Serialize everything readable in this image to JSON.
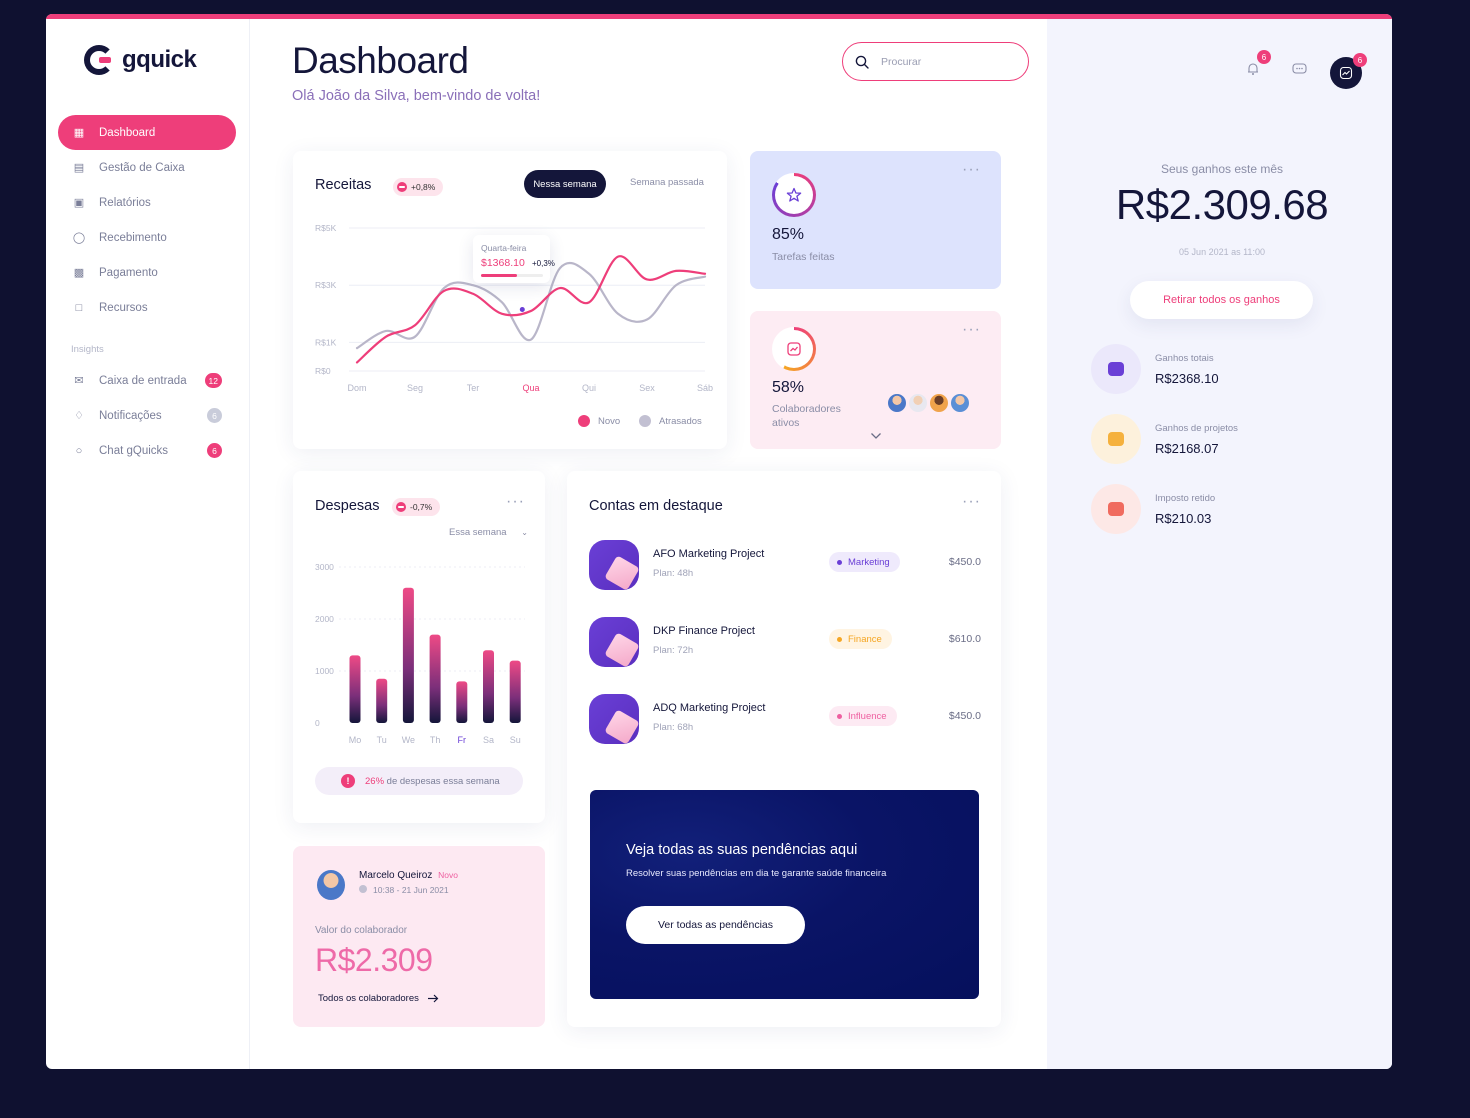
{
  "brand": {
    "name": "gquick",
    "accent": "#ee3e7a",
    "dark": "#14163a"
  },
  "sidebar": {
    "items": [
      {
        "label": "Dashboard",
        "icon": "grid-icon",
        "active": true
      },
      {
        "label": "Gestão de Caixa",
        "icon": "chart-icon"
      },
      {
        "label": "Relatórios",
        "icon": "document-icon"
      },
      {
        "label": "Recebimento",
        "icon": "receive-icon"
      },
      {
        "label": "Pagamento",
        "icon": "payment-icon"
      },
      {
        "label": "Recursos",
        "icon": "wallet-icon"
      }
    ],
    "section_label": "Insights",
    "insights": [
      {
        "label": "Caixa de entrada",
        "icon": "mail-icon",
        "badge": "12"
      },
      {
        "label": "Notificações",
        "icon": "bell-icon",
        "badge": "6"
      },
      {
        "label": "Chat gQuicks",
        "icon": "chat-icon",
        "badge": "6"
      }
    ]
  },
  "header": {
    "title": "Dashboard",
    "subtitle": "Olá João da Silva, bem-vindo de volta!",
    "search_placeholder": "Procurar"
  },
  "receitas": {
    "title": "Receitas",
    "change": "+0,8%",
    "tab_active": "Nessa semana",
    "tab_inactive": "Semana passada",
    "tooltip": {
      "day": "Quarta-feira",
      "value": "$1368.10",
      "change": "+0,3%"
    },
    "legend": [
      "Novo",
      "Atrasados"
    ]
  },
  "stats": [
    {
      "value": "85%",
      "label": "Tarefas feitas",
      "icon": "star-icon"
    },
    {
      "value": "58%",
      "label": "Colaboradores ativos",
      "icon": "trend-icon"
    }
  ],
  "despesas": {
    "title": "Despesas",
    "change": "-0,7%",
    "period": "Essa semana",
    "footer_pct": "26%",
    "footer_text": "de despesas essa semana"
  },
  "colaborador": {
    "name": "Marcelo Queiroz",
    "tag": "Novo",
    "time": "10:38 - 21 Jun 2021",
    "label": "Valor do colaborador",
    "value": "R$2.309",
    "link": "Todos os colaboradores"
  },
  "contas": {
    "title": "Contas em destaque",
    "items": [
      {
        "name": "AFO Marketing Project",
        "plan": "Plan: 48h",
        "tag": "Marketing",
        "tag_color": "#6a3fd6",
        "tag_bg": "#efeafc",
        "amount": "$450.0"
      },
      {
        "name": "DKP Finance Project",
        "plan": "Plan: 72h",
        "tag": "Finance",
        "tag_color": "#f5a623",
        "tag_bg": "#fff4e2",
        "amount": "$610.0"
      },
      {
        "name": "ADQ Marketing Project",
        "plan": "Plan: 68h",
        "tag": "Influence",
        "tag_color": "#ee5fa0",
        "tag_bg": "#fdeaf3",
        "amount": "$450.0"
      }
    ],
    "banner_title": "Veja todas as suas pendências aqui",
    "banner_text": "Resolver suas pendências em dia te garante saúde financeira",
    "banner_button": "Ver todas as pendências"
  },
  "right": {
    "notif_count": "6",
    "profile_count": "6",
    "earn_label": "Seus ganhos este mês",
    "earn_value": "R$2.309.68",
    "earn_date": "05 Jun 2021 as 11:00",
    "withdraw": "Retirar todos os ganhos",
    "ganhos": [
      {
        "label": "Ganhos totais",
        "value": "R$2368.10",
        "color": "#6a3fd6",
        "bg": "#ebe8fb"
      },
      {
        "label": "Ganhos de projetos",
        "value": "R$2168.07",
        "color": "#f5b13d",
        "bg": "#fdf1dc"
      },
      {
        "label": "Imposto retido",
        "value": "R$210.03",
        "color": "#f06b5f",
        "bg": "#fde8e6"
      }
    ]
  },
  "chart_data": [
    {
      "type": "line",
      "title": "Receitas",
      "categories": [
        "Dom",
        "Seg",
        "Ter",
        "Qua",
        "Qui",
        "Sex",
        "Sáb"
      ],
      "ytick_labels": [
        "R$0",
        "R$1K",
        "R$3K",
        "R$5K"
      ],
      "ytick_positions": [
        0,
        1,
        3,
        5
      ],
      "ylim": [
        0,
        5
      ],
      "highlight_category": "Qua",
      "series": [
        {
          "name": "Novo",
          "color": "#ee3e7a",
          "x": [
            0,
            0.5,
            1,
            1.5,
            2,
            2.5,
            3,
            3.5,
            4,
            4.5,
            5,
            5.5,
            6
          ],
          "values": [
            0.3,
            1.2,
            1.6,
            2.8,
            2.7,
            2.0,
            2.1,
            2.9,
            2.4,
            4.0,
            3.2,
            3.5,
            3.4
          ]
        },
        {
          "name": "Atrasados",
          "color": "#b9b6c9",
          "x": [
            0,
            0.5,
            1,
            1.5,
            2,
            2.5,
            3,
            3.5,
            4,
            4.5,
            5,
            5.5,
            6
          ],
          "values": [
            0.8,
            1.4,
            1.2,
            2.9,
            3.0,
            2.4,
            1.1,
            3.6,
            3.4,
            2.0,
            1.8,
            3.0,
            3.3
          ]
        }
      ]
    },
    {
      "type": "bar",
      "title": "Despesas",
      "categories": [
        "Mo",
        "Tu",
        "We",
        "Th",
        "Fr",
        "Sa",
        "Su"
      ],
      "values": [
        1300,
        850,
        2600,
        1700,
        800,
        1400,
        1200
      ],
      "yticks": [
        0,
        1000,
        2000,
        3000
      ],
      "ylim": [
        0,
        3000
      ],
      "highlight_category": "Fr"
    }
  ]
}
